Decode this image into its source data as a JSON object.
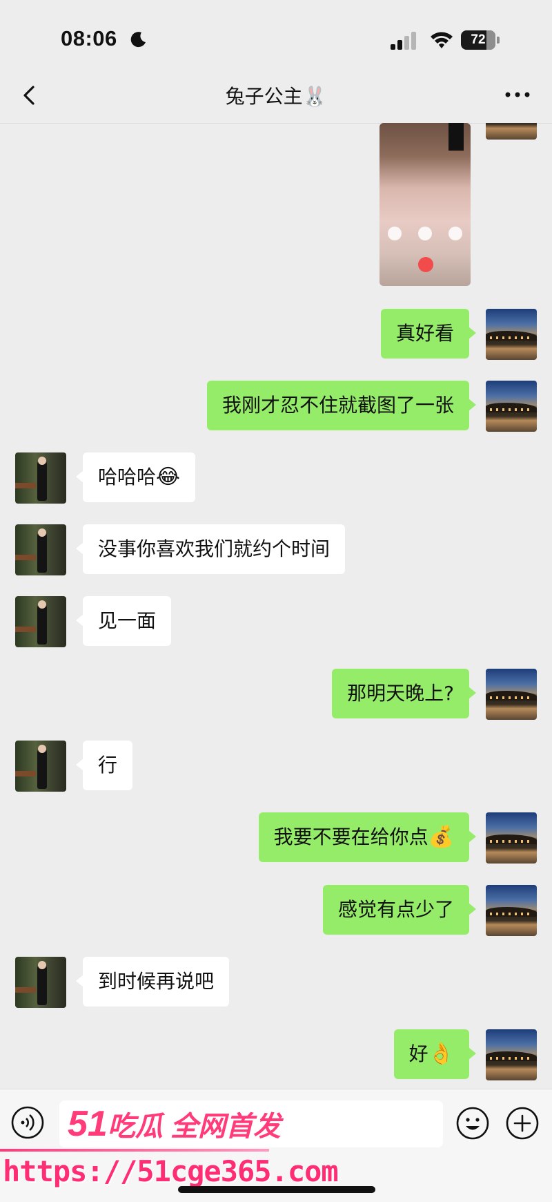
{
  "status": {
    "time": "08:06",
    "battery": "72"
  },
  "nav": {
    "title": "兔子公主🐰"
  },
  "messages": [
    {
      "side": "out",
      "text": "真好看"
    },
    {
      "side": "out",
      "text": "我刚才忍不住就截图了一张"
    },
    {
      "side": "in",
      "text": "哈哈哈",
      "emoji": "😂"
    },
    {
      "side": "in",
      "text": "没事你喜欢我们就约个时间"
    },
    {
      "side": "in",
      "text": "见一面"
    },
    {
      "side": "out",
      "text": "那明天晚上?"
    },
    {
      "side": "in",
      "text": "行"
    },
    {
      "side": "out",
      "text": "我要不要在给你点",
      "emoji": "💰"
    },
    {
      "side": "out",
      "text": "感觉有点少了"
    },
    {
      "side": "in",
      "text": "到时候再说吧"
    },
    {
      "side": "out",
      "text": "好",
      "emoji": "👌"
    }
  ],
  "watermark": {
    "brand_num": "51",
    "brand_text": "吃瓜 全网首发",
    "url": "https://51cge365.com"
  },
  "colors": {
    "outgoing_bubble": "#95ec69",
    "incoming_bubble": "#ffffff",
    "background": "#ededed",
    "watermark": "#ff3b7a"
  },
  "icons": [
    "moon-icon",
    "signal-icon",
    "wifi-icon",
    "battery-icon",
    "back-icon",
    "more-icon",
    "voice-icon",
    "emoji-icon",
    "plus-icon"
  ]
}
